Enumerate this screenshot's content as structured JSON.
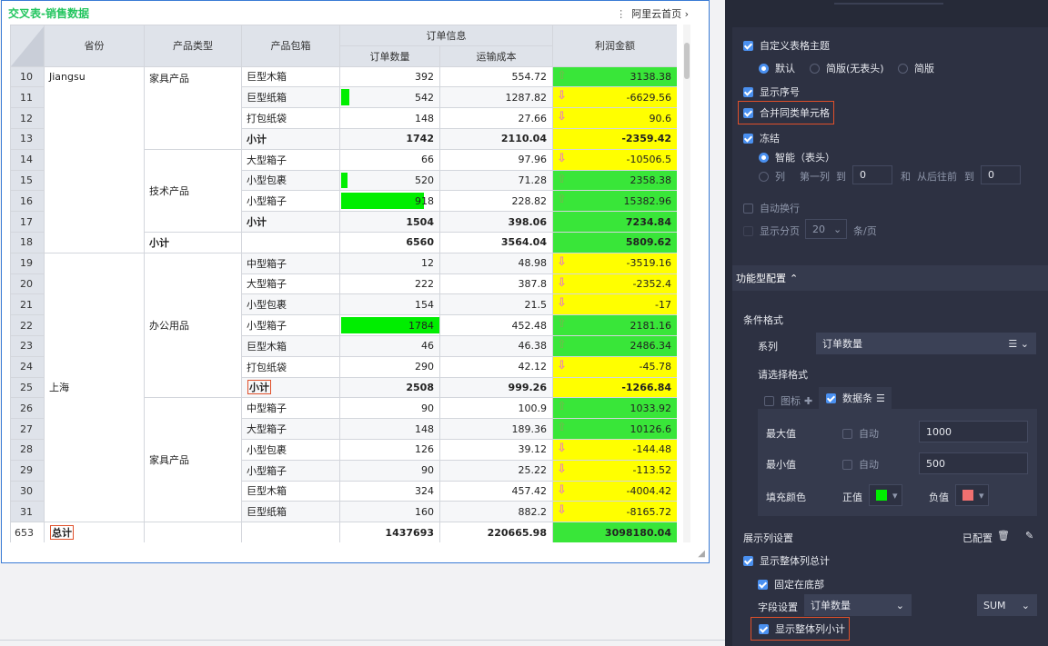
{
  "report": {
    "title": "交叉表-销售数据",
    "link": "阿里云首页",
    "headers": {
      "province": "省份",
      "category": "产品类型",
      "package": "产品包箱",
      "order_info": "订单信息",
      "order_qty": "订单数量",
      "ship_cost": "运输成本",
      "profit": "利润金额"
    },
    "rows": [
      {
        "idx": "10",
        "pkg": "巨型木箱",
        "qty": "392",
        "cost": "554.72",
        "profit": "3138.38",
        "dir": "up"
      },
      {
        "idx": "11",
        "pkg": "巨型纸箱",
        "qty": "542",
        "cost": "1287.82",
        "profit": "-6629.56",
        "dir": "down"
      },
      {
        "idx": "12",
        "pkg": "打包纸袋",
        "qty": "148",
        "cost": "27.66",
        "profit": "90.6",
        "dir": "down"
      },
      {
        "idx": "13",
        "pkg": "小计",
        "qty": "1742",
        "cost": "2110.04",
        "profit": "-2359.42",
        "dir": ""
      },
      {
        "idx": "14",
        "pkg": "大型箱子",
        "qty": "66",
        "cost": "97.96",
        "profit": "-10506.5",
        "dir": "down"
      },
      {
        "idx": "15",
        "pkg": "小型包裹",
        "qty": "520",
        "cost": "71.28",
        "profit": "2358.38",
        "dir": "up"
      },
      {
        "idx": "16",
        "pkg": "小型箱子",
        "qty": "918",
        "cost": "228.82",
        "profit": "15382.96",
        "dir": "up"
      },
      {
        "idx": "17",
        "pkg": "小计",
        "qty": "1504",
        "cost": "398.06",
        "profit": "7234.84",
        "dir": ""
      },
      {
        "idx": "18",
        "cat": "小计",
        "pkg": "",
        "qty": "6560",
        "cost": "3564.04",
        "profit": "5809.62",
        "dir": ""
      },
      {
        "idx": "19",
        "pkg": "中型箱子",
        "qty": "12",
        "cost": "48.98",
        "profit": "-3519.16",
        "dir": "down"
      },
      {
        "idx": "20",
        "pkg": "大型箱子",
        "qty": "222",
        "cost": "387.8",
        "profit": "-2352.4",
        "dir": "down"
      },
      {
        "idx": "21",
        "pkg": "小型包裹",
        "qty": "154",
        "cost": "21.5",
        "profit": "-17",
        "dir": "down"
      },
      {
        "idx": "22",
        "pkg": "小型箱子",
        "qty": "1784",
        "cost": "452.48",
        "profit": "2181.16",
        "dir": "up"
      },
      {
        "idx": "23",
        "pkg": "巨型木箱",
        "qty": "46",
        "cost": "46.38",
        "profit": "2486.34",
        "dir": "up"
      },
      {
        "idx": "24",
        "pkg": "打包纸袋",
        "qty": "290",
        "cost": "42.12",
        "profit": "-45.78",
        "dir": "down"
      },
      {
        "idx": "25",
        "pkg": "小计",
        "qty": "2508",
        "cost": "999.26",
        "profit": "-1266.84",
        "dir": ""
      },
      {
        "idx": "26",
        "pkg": "中型箱子",
        "qty": "90",
        "cost": "100.9",
        "profit": "1033.92",
        "dir": "up"
      },
      {
        "idx": "27",
        "pkg": "大型箱子",
        "qty": "148",
        "cost": "189.36",
        "profit": "10126.6",
        "dir": "up"
      },
      {
        "idx": "28",
        "pkg": "小型包裹",
        "qty": "126",
        "cost": "39.12",
        "profit": "-144.48",
        "dir": "down"
      },
      {
        "idx": "29",
        "pkg": "小型箱子",
        "qty": "90",
        "cost": "25.22",
        "profit": "-113.52",
        "dir": "down"
      },
      {
        "idx": "30",
        "pkg": "巨型木箱",
        "qty": "324",
        "cost": "457.42",
        "profit": "-4004.42",
        "dir": "down"
      },
      {
        "idx": "31",
        "pkg": "巨型纸箱",
        "qty": "160",
        "cost": "882.2",
        "profit": "-8165.72",
        "dir": "down"
      }
    ],
    "merged": {
      "province_jiangsu": "Jiangsu",
      "province_shanghai": "上海",
      "cat_furniture": "家具产品",
      "cat_tech": "技术产品",
      "cat_office": "办公用品",
      "cat_furniture2": "家具产品"
    },
    "total": {
      "idx": "653",
      "label": "总计",
      "qty": "1437693",
      "cost": "220665.98",
      "profit": "3098180.04"
    },
    "databar": {
      "min": 500,
      "max": 1000,
      "positive_color": "#00ee00",
      "negative_color": "#f07070"
    },
    "colors": {
      "positive_bg": "#39e639",
      "negative_bg": "#ffff00",
      "title": "#22c55e",
      "highlight": "#e0502a"
    }
  },
  "panel": {
    "custom_theme": "自定义表格主题",
    "theme_default": "默认",
    "theme_simple_nohead": "简版(无表头)",
    "theme_simple": "简版",
    "show_index": "显示序号",
    "merge_cells": "合并同类单元格",
    "freeze": "冻结",
    "freeze_smart": "智能（表头）",
    "freeze_col": "列",
    "freeze_first_col": "第一列",
    "freeze_to": "到",
    "freeze_from_val": "0",
    "freeze_and": "和",
    "freeze_from_back": "从后往前",
    "freeze_to2": "到",
    "freeze_back_val": "0",
    "auto_wrap": "自动换行",
    "show_paging": "显示分页",
    "page_size": "20",
    "per_page": "条/页",
    "func_config": "功能型配置",
    "cond_format": "条件格式",
    "series_label": "系列",
    "series_value": "订单数量",
    "choose_format": "请选择格式",
    "icon_label": "图标",
    "databar_label": "数据条",
    "max_label": "最大值",
    "auto1": "自动",
    "max_value": "1000",
    "min_label": "最小值",
    "auto2": "自动",
    "min_value": "500",
    "fill_color": "填充颜色",
    "positive": "正值",
    "negative": "负值",
    "display_col": "展示列设置",
    "configured": "已配置",
    "show_total": "显示整体列总计",
    "fix_bottom": "固定在底部",
    "field_setting": "字段设置",
    "field_value": "订单数量",
    "agg_value": "SUM",
    "show_subtotal": "显示整体列小计"
  }
}
